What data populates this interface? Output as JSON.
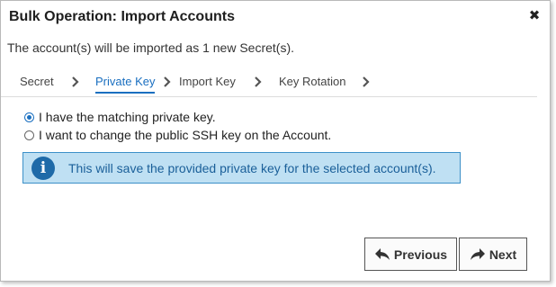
{
  "dialog": {
    "title": "Bulk Operation: Import Accounts",
    "close_label": "✖",
    "description": "The account(s) will be imported as 1 new Secret(s)."
  },
  "steps": [
    {
      "label": "Secret"
    },
    {
      "label": "Private Key"
    },
    {
      "label": "Import Key"
    },
    {
      "label": "Key Rotation"
    }
  ],
  "options": [
    {
      "label": "I have the matching private key.",
      "checked": true
    },
    {
      "label": "I want to change the public SSH key on the Account.",
      "checked": false
    }
  ],
  "info": {
    "icon_letter": "i",
    "text": "This will save the provided private key for the selected account(s)."
  },
  "buttons": {
    "previous": "Previous",
    "next": "Next"
  },
  "colors": {
    "accent": "#1a6fc0",
    "info_bg": "#bfe0f3",
    "info_border": "#3c90c8"
  }
}
